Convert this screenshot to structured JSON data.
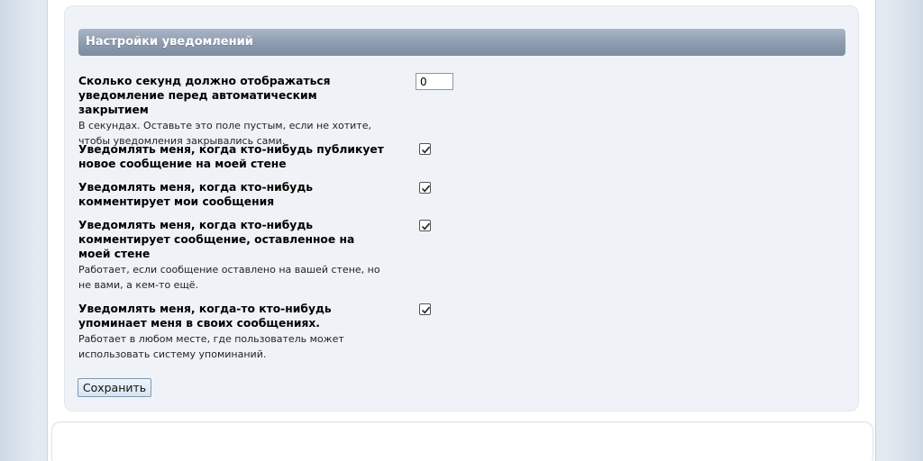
{
  "section": {
    "title": "Настройки уведомлений"
  },
  "settings": [
    {
      "label": "Сколько секунд должно отображаться уведомление перед автоматическим закрытием",
      "hint": "В секундах. Оставьте это поле пустым, если не хотите, чтобы уведомления закрывались сами.",
      "value": "0"
    },
    {
      "label": "Уведомлять меня, когда кто-нибудь публикует новое сообщение на моей стене",
      "checked": true
    },
    {
      "label": "Уведомлять меня, когда кто-нибудь комментирует мои сообщения",
      "checked": true
    },
    {
      "label": "Уведомлять меня, когда кто-нибудь комментирует сообщение, оставленное на моей стене",
      "hint": "Работает, если сообщение оставлено на вашей стене, но не вами, а кем-то ещё.",
      "checked": true
    },
    {
      "label": "Уведомлять меня, когда-то кто-нибудь упоминает меня в своих сообщениях.",
      "hint": "Работает в любом месте, где пользователь может использовать систему упоминаний.",
      "checked": true
    }
  ],
  "actions": {
    "save_label": "Сохранить"
  }
}
